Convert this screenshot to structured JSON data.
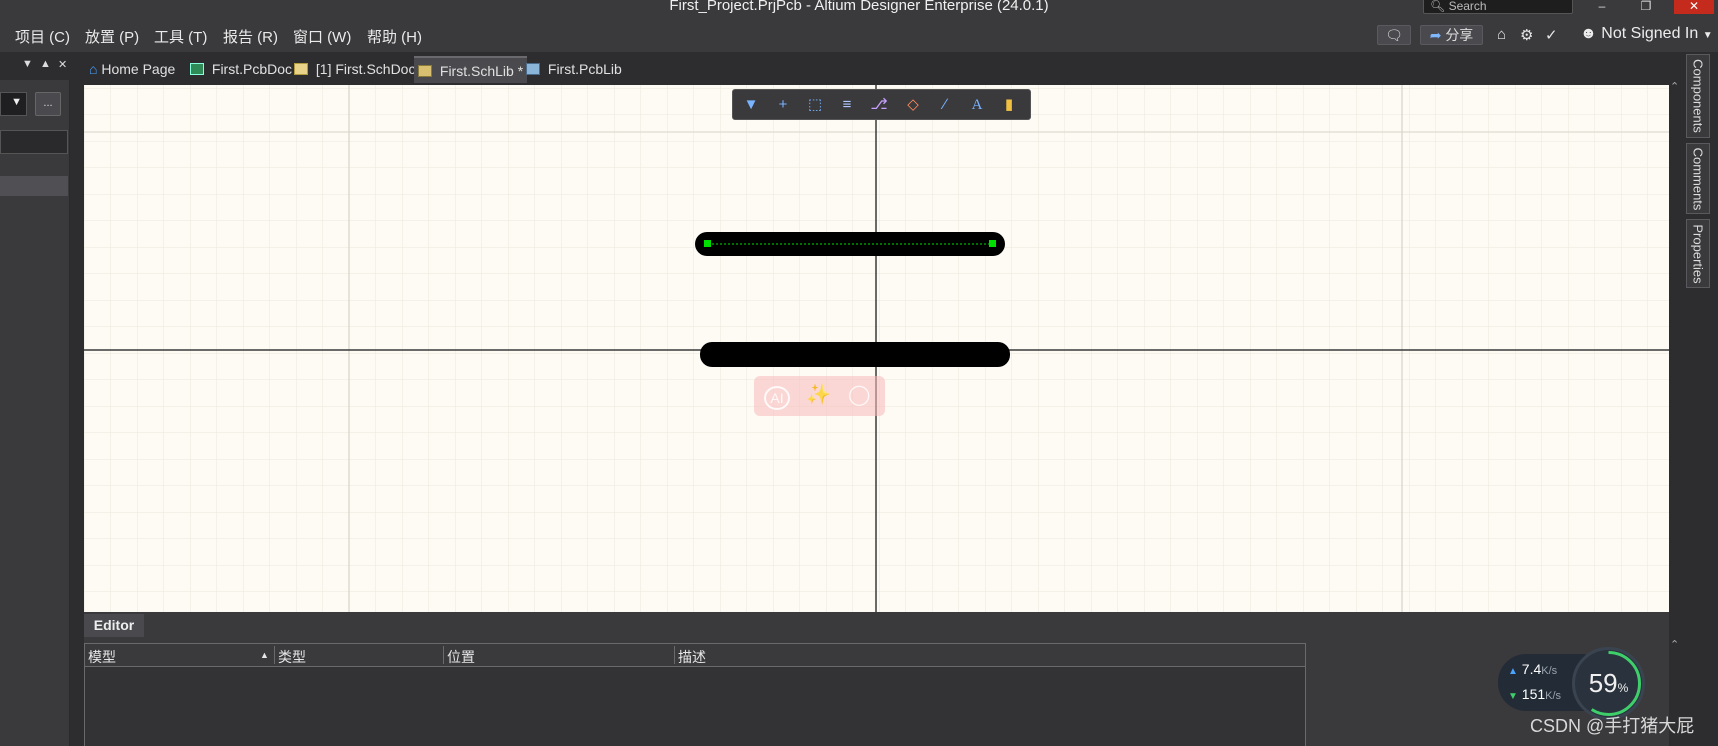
{
  "window": {
    "title": "First_Project.PrjPcb - Altium Designer Enterprise (24.0.1)",
    "search_placeholder": "Search",
    "minimize": "–",
    "restore": "❐",
    "close": "✕"
  },
  "menu": {
    "items": [
      {
        "label": "项目 (C)"
      },
      {
        "label": "放置 (P)"
      },
      {
        "label": "工具 (T)"
      },
      {
        "label": "报告 (R)"
      },
      {
        "label": "窗口 (W)"
      },
      {
        "label": "帮助 (H)"
      }
    ],
    "share_label": "分享",
    "signed_in_label": "Not Signed In"
  },
  "left_panel": {
    "more_label": "..."
  },
  "tabs": [
    {
      "label": "Home Page",
      "icon": "home-icon"
    },
    {
      "label": "First.PcbDoc",
      "icon": "pcb-document-icon"
    },
    {
      "label": "[1] First.SchDoc",
      "icon": "schematic-document-icon"
    },
    {
      "label": "First.SchLib *",
      "icon": "schematic-library-icon",
      "active": true
    },
    {
      "label": "First.PcbLib",
      "icon": "pcb-library-icon"
    }
  ],
  "floating_toolbar": {
    "icons": [
      "filter-icon",
      "add-icon",
      "rectangle-select-icon",
      "align-icon",
      "place-pin-icon",
      "erase-icon",
      "line-icon",
      "text-icon",
      "component-icon"
    ]
  },
  "ai_overlay": {
    "ai_label": "AI"
  },
  "right_panels": [
    {
      "label": "Components"
    },
    {
      "label": "Comments"
    },
    {
      "label": "Properties"
    }
  ],
  "editor": {
    "tab_label": "Editor",
    "columns": [
      {
        "label": "模型"
      },
      {
        "label": "类型"
      },
      {
        "label": "位置"
      },
      {
        "label": "描述"
      }
    ]
  },
  "network_widget": {
    "upload": "7.4",
    "upload_unit": "K/s",
    "download": "151",
    "download_unit": "K/s",
    "percent": "59",
    "percent_sign": "%"
  },
  "watermark": "CSDN @手打猪大屁",
  "colors": {
    "canvas_bg": "#fdfbf4",
    "selection_green": "#00e000",
    "overlay_pink": "#f8b9b9"
  }
}
